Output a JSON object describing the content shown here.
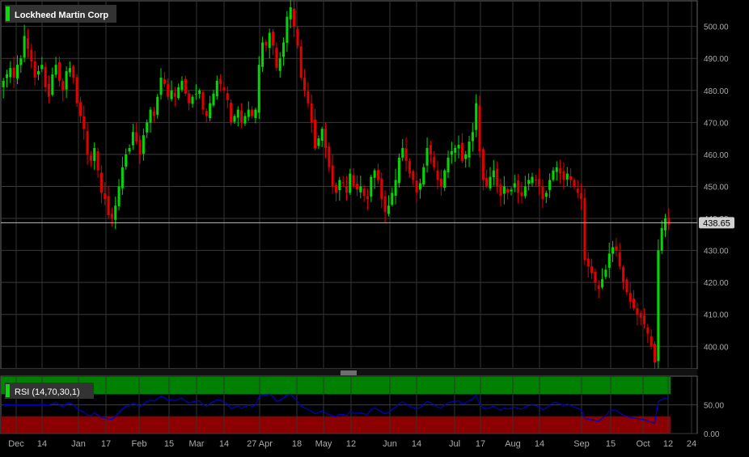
{
  "chart_data": [
    {
      "type": "candlestick",
      "title": "Lockheed Martin Corp",
      "last_price_label": "438.65",
      "last_price": 438.65,
      "ylim": [
        393,
        508
      ],
      "yticks": [
        400,
        410,
        420,
        430,
        440,
        450,
        460,
        470,
        480,
        490,
        500
      ],
      "ytick_labels": [
        "400.00",
        "410.00",
        "420.00",
        "430.00",
        "440.00",
        "450.00",
        "460.00",
        "470.00",
        "480.00",
        "490.00",
        "500.00"
      ],
      "xtick_labels": [
        "Dec",
        "14",
        "Jan",
        "17",
        "Feb",
        "15",
        "Mar",
        "14",
        "27 Apr",
        "18",
        "May",
        "12",
        "Jun",
        "14",
        "Jul",
        "17",
        "Aug",
        "14",
        "Sep",
        "15",
        "Oct",
        "12",
        "24"
      ],
      "grid": true,
      "up_color": "#00d800",
      "down_color": "#e00000",
      "series_close": [
        483,
        485,
        487,
        484,
        488,
        490,
        497,
        493,
        489,
        484,
        486,
        488,
        481,
        478,
        485,
        488,
        483,
        480,
        486,
        487,
        484,
        476,
        472,
        468,
        460,
        458,
        462,
        455,
        448,
        446,
        441,
        440,
        444,
        450,
        456,
        460,
        462,
        467,
        464,
        460,
        466,
        470,
        474,
        472,
        478,
        484,
        482,
        478,
        480,
        478,
        481,
        483,
        479,
        476,
        478,
        479,
        480,
        474,
        472,
        476,
        479,
        483,
        482,
        480,
        477,
        470,
        472,
        474,
        470,
        472,
        474,
        472,
        474,
        488,
        495,
        494,
        498,
        494,
        487,
        490,
        495,
        503,
        506,
        500,
        494,
        484,
        480,
        476,
        470,
        462,
        465,
        468,
        462,
        456,
        450,
        448,
        452,
        451,
        448,
        454,
        450,
        449,
        450,
        447,
        446,
        453,
        455,
        452,
        446,
        442,
        444,
        448,
        452,
        459,
        462,
        458,
        454,
        452,
        448,
        451,
        456,
        462,
        460,
        456,
        452,
        450,
        455,
        459,
        461,
        462,
        463,
        458,
        460,
        464,
        467,
        476,
        461,
        452,
        450,
        453,
        455,
        450,
        447,
        450,
        448,
        449,
        451,
        448,
        447,
        450,
        452,
        453,
        452,
        450,
        446,
        448,
        452,
        455,
        456,
        454,
        452,
        454,
        452,
        450,
        448,
        446,
        427,
        425,
        423,
        420,
        418,
        421,
        424,
        429,
        431,
        430,
        425,
        420,
        417,
        414,
        412,
        410,
        409,
        407,
        404,
        400,
        395,
        430,
        437,
        440,
        438
      ]
    },
    {
      "type": "line",
      "title": "RSI (14,70,30,1)",
      "ylim": [
        0,
        100
      ],
      "yticks": [
        0,
        50
      ],
      "ytick_labels": [
        "0.00",
        "50.00"
      ],
      "overbought_color": "#008000",
      "oversold_color": "#8b0000",
      "line_color": "#0000cc"
    }
  ]
}
